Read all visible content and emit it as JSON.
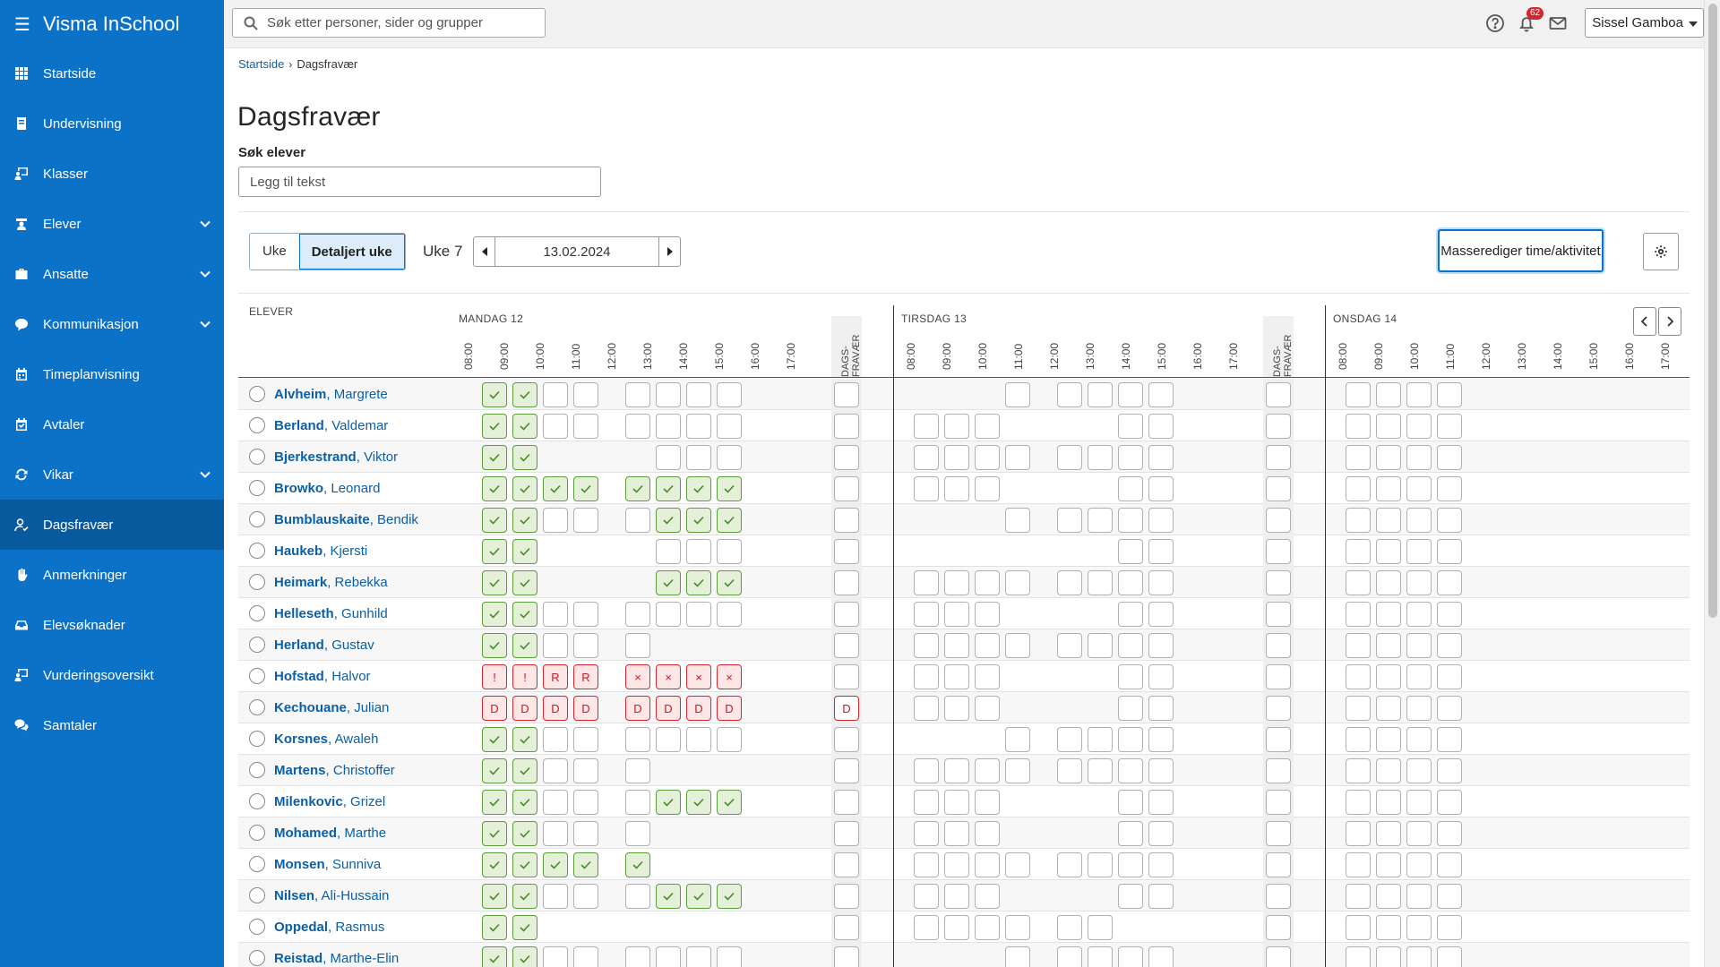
{
  "app": {
    "title": "Visma InSchool"
  },
  "sidebar": {
    "items": [
      {
        "label": "Startside",
        "icon": "grid-icon",
        "expand": false,
        "active": false
      },
      {
        "label": "Undervisning",
        "icon": "book-icon",
        "expand": false,
        "active": false
      },
      {
        "label": "Klasser",
        "icon": "classroom-icon",
        "expand": false,
        "active": false
      },
      {
        "label": "Elever",
        "icon": "student-icon",
        "expand": true,
        "active": false
      },
      {
        "label": "Ansatte",
        "icon": "briefcase-icon",
        "expand": true,
        "active": false
      },
      {
        "label": "Kommunikasjon",
        "icon": "chat-icon",
        "expand": true,
        "active": false
      },
      {
        "label": "Timeplanvisning",
        "icon": "calendar-icon",
        "expand": false,
        "active": false
      },
      {
        "label": "Avtaler",
        "icon": "calendar-check-icon",
        "expand": false,
        "active": false
      },
      {
        "label": "Vikar",
        "icon": "swap-icon",
        "expand": true,
        "active": false
      },
      {
        "label": "Dagsfravær",
        "icon": "user-check-icon",
        "expand": false,
        "active": true
      },
      {
        "label": "Anmerkninger",
        "icon": "hand-icon",
        "expand": false,
        "active": false
      },
      {
        "label": "Elevsøknader",
        "icon": "inbox-icon",
        "expand": false,
        "active": false
      },
      {
        "label": "Vurderingsoversikt",
        "icon": "board-icon",
        "expand": false,
        "active": false
      },
      {
        "label": "Samtaler",
        "icon": "conversation-icon",
        "expand": false,
        "active": false
      }
    ]
  },
  "topbar": {
    "search_placeholder": "Søk etter personer, sider og grupper",
    "notification_count": "62",
    "user_name": "Sissel Gamboa"
  },
  "breadcrumb": {
    "home": "Startside",
    "current": "Dagsfravær"
  },
  "page": {
    "title": "Dagsfravær",
    "search_label": "Søk elever",
    "search_placeholder": "Legg til tekst"
  },
  "controls": {
    "view_week": "Uke",
    "view_detailed": "Detaljert uke",
    "week_label": "Uke 7",
    "date": "13.02.2024",
    "mass_edit": "Masserediger time/aktivitet"
  },
  "grid": {
    "students_header": "ELEVER",
    "dags_header": "DAGS-FRAVÆR",
    "hours": [
      "08:00",
      "09:00",
      "10:00",
      "11:00",
      "12:00",
      "13:00",
      "14:00",
      "15:00",
      "16:00",
      "17:00"
    ],
    "days": [
      {
        "name": "MANDAG 12"
      },
      {
        "name": "TIRSDAG 13"
      },
      {
        "name": "ONSDAG 14"
      }
    ],
    "students": [
      {
        "last": "Alvheim",
        "first": "Margrete",
        "mon": [
          "ok",
          "ok",
          "e",
          "e",
          "e",
          "e",
          "e",
          "e"
        ],
        "mon_d": "",
        "tue": [
          "",
          "",
          "",
          "e",
          "e",
          "e",
          "e",
          "e"
        ],
        "wed": [
          "e",
          "e",
          "e",
          "e"
        ]
      },
      {
        "last": "Berland",
        "first": "Valdemar",
        "mon": [
          "ok",
          "ok",
          "e",
          "e",
          "e",
          "e",
          "e",
          "e"
        ],
        "mon_d": "",
        "tue": [
          "e",
          "e",
          "e",
          "",
          "",
          "",
          "e",
          "e"
        ],
        "wed": [
          "e",
          "e",
          "e",
          "e"
        ]
      },
      {
        "last": "Bjerkestrand",
        "first": "Viktor",
        "mon": [
          "ok",
          "ok",
          "",
          "",
          "",
          "e",
          "e",
          "e"
        ],
        "mon_d": "",
        "tue": [
          "e",
          "e",
          "e",
          "e",
          "e",
          "e",
          "e",
          "e"
        ],
        "wed": [
          "e",
          "e",
          "e",
          "e"
        ]
      },
      {
        "last": "Browko",
        "first": "Leonard",
        "mon": [
          "ok",
          "ok",
          "ok",
          "ok",
          "ok",
          "ok",
          "ok",
          "ok"
        ],
        "mon_d": "",
        "tue": [
          "e",
          "e",
          "e",
          "",
          "",
          "",
          "e",
          "e"
        ],
        "wed": [
          "e",
          "e",
          "e",
          "e"
        ]
      },
      {
        "last": "Bumblauskaite",
        "first": "Bendik",
        "mon": [
          "ok",
          "ok",
          "e",
          "e",
          "e",
          "ok",
          "ok",
          "ok"
        ],
        "mon_d": "",
        "tue": [
          "",
          "",
          "",
          "e",
          "e",
          "e",
          "e",
          "e"
        ],
        "wed": [
          "e",
          "e",
          "e",
          "e"
        ]
      },
      {
        "last": "Haukeb",
        "first": "Kjersti",
        "mon": [
          "ok",
          "ok",
          "",
          "",
          "",
          "e",
          "e",
          "e"
        ],
        "mon_d": "",
        "tue": [
          "",
          "",
          "",
          "",
          "",
          "",
          "e",
          "e"
        ],
        "wed": [
          "e",
          "e",
          "e",
          "e"
        ]
      },
      {
        "last": "Heimark",
        "first": "Rebekka",
        "mon": [
          "ok",
          "ok",
          "",
          "",
          "",
          "ok",
          "ok",
          "ok"
        ],
        "mon_d": "",
        "tue": [
          "e",
          "e",
          "e",
          "e",
          "e",
          "e",
          "e",
          "e"
        ],
        "wed": [
          "e",
          "e",
          "e",
          "e"
        ]
      },
      {
        "last": "Helleseth",
        "first": "Gunhild",
        "mon": [
          "ok",
          "ok",
          "e",
          "e",
          "e",
          "e",
          "e",
          "e"
        ],
        "mon_d": "",
        "tue": [
          "e",
          "e",
          "e",
          "",
          "",
          "",
          "e",
          "e"
        ],
        "wed": [
          "e",
          "e",
          "e",
          "e"
        ]
      },
      {
        "last": "Herland",
        "first": "Gustav",
        "mon": [
          "ok",
          "ok",
          "e",
          "e",
          "e",
          "",
          "",
          ""
        ],
        "mon_d": "",
        "tue": [
          "e",
          "e",
          "e",
          "e",
          "e",
          "e",
          "e",
          "e"
        ],
        "wed": [
          "e",
          "e",
          "e",
          "e"
        ]
      },
      {
        "last": "Hofstad",
        "first": "Halvor",
        "mon": [
          "!",
          "!",
          "R",
          "R",
          "×",
          "×",
          "×",
          "×"
        ],
        "mon_d": "",
        "tue": [
          "e",
          "e",
          "e",
          "",
          "",
          "",
          "e",
          "e"
        ],
        "wed": [
          "e",
          "e",
          "e",
          "e"
        ]
      },
      {
        "last": "Kechouane",
        "first": "Julian",
        "mon": [
          "D",
          "D",
          "D",
          "D",
          "D",
          "D",
          "D",
          "D"
        ],
        "mon_d": "D",
        "tue": [
          "e",
          "e",
          "e",
          "",
          "",
          "",
          "e",
          "e"
        ],
        "wed": [
          "e",
          "e",
          "e",
          "e"
        ]
      },
      {
        "last": "Korsnes",
        "first": "Awaleh",
        "mon": [
          "ok",
          "ok",
          "e",
          "e",
          "e",
          "e",
          "e",
          "e"
        ],
        "mon_d": "",
        "tue": [
          "",
          "",
          "",
          "e",
          "e",
          "e",
          "e",
          "e"
        ],
        "wed": [
          "e",
          "e",
          "e",
          "e"
        ]
      },
      {
        "last": "Martens",
        "first": "Christoffer",
        "mon": [
          "ok",
          "ok",
          "e",
          "e",
          "e",
          "",
          "",
          ""
        ],
        "mon_d": "",
        "tue": [
          "e",
          "e",
          "e",
          "e",
          "e",
          "e",
          "e",
          "e"
        ],
        "wed": [
          "e",
          "e",
          "e",
          "e"
        ]
      },
      {
        "last": "Milenkovic",
        "first": "Grizel",
        "mon": [
          "ok",
          "ok",
          "e",
          "e",
          "e",
          "ok",
          "ok",
          "ok"
        ],
        "mon_d": "",
        "tue": [
          "e",
          "e",
          "e",
          "",
          "",
          "",
          "e",
          "e"
        ],
        "wed": [
          "e",
          "e",
          "e",
          "e"
        ]
      },
      {
        "last": "Mohamed",
        "first": "Marthe",
        "mon": [
          "ok",
          "ok",
          "e",
          "e",
          "e",
          "",
          "",
          ""
        ],
        "mon_d": "",
        "tue": [
          "e",
          "e",
          "e",
          "",
          "",
          "",
          "e",
          "e"
        ],
        "wed": [
          "e",
          "e",
          "e",
          "e"
        ]
      },
      {
        "last": "Monsen",
        "first": "Sunniva",
        "mon": [
          "ok",
          "ok",
          "ok",
          "ok",
          "ok",
          "",
          "",
          ""
        ],
        "mon_d": "",
        "tue": [
          "e",
          "e",
          "e",
          "e",
          "e",
          "e",
          "e",
          "e"
        ],
        "wed": [
          "e",
          "e",
          "e",
          "e"
        ]
      },
      {
        "last": "Nilsen",
        "first": "Ali-Hussain",
        "mon": [
          "ok",
          "ok",
          "e",
          "e",
          "e",
          "ok",
          "ok",
          "ok"
        ],
        "mon_d": "",
        "tue": [
          "e",
          "e",
          "e",
          "",
          "",
          "",
          "e",
          "e"
        ],
        "wed": [
          "e",
          "e",
          "e",
          "e"
        ]
      },
      {
        "last": "Oppedal",
        "first": "Rasmus",
        "mon": [
          "ok",
          "ok",
          "",
          "",
          "",
          "",
          "",
          ""
        ],
        "mon_d": "",
        "tue": [
          "e",
          "e",
          "e",
          "e",
          "e",
          "e",
          "",
          ""
        ],
        "wed": [
          "e",
          "e",
          "e",
          "e"
        ]
      },
      {
        "last": "Reistad",
        "first": "Marthe-Elin",
        "mon": [
          "ok",
          "ok",
          "e",
          "e",
          "e",
          "e",
          "e",
          "e"
        ],
        "mon_d": "",
        "tue": [
          "",
          "",
          "",
          "e",
          "e",
          "e",
          "e",
          "e"
        ],
        "wed": [
          "e",
          "e",
          "e",
          "e"
        ]
      }
    ]
  }
}
